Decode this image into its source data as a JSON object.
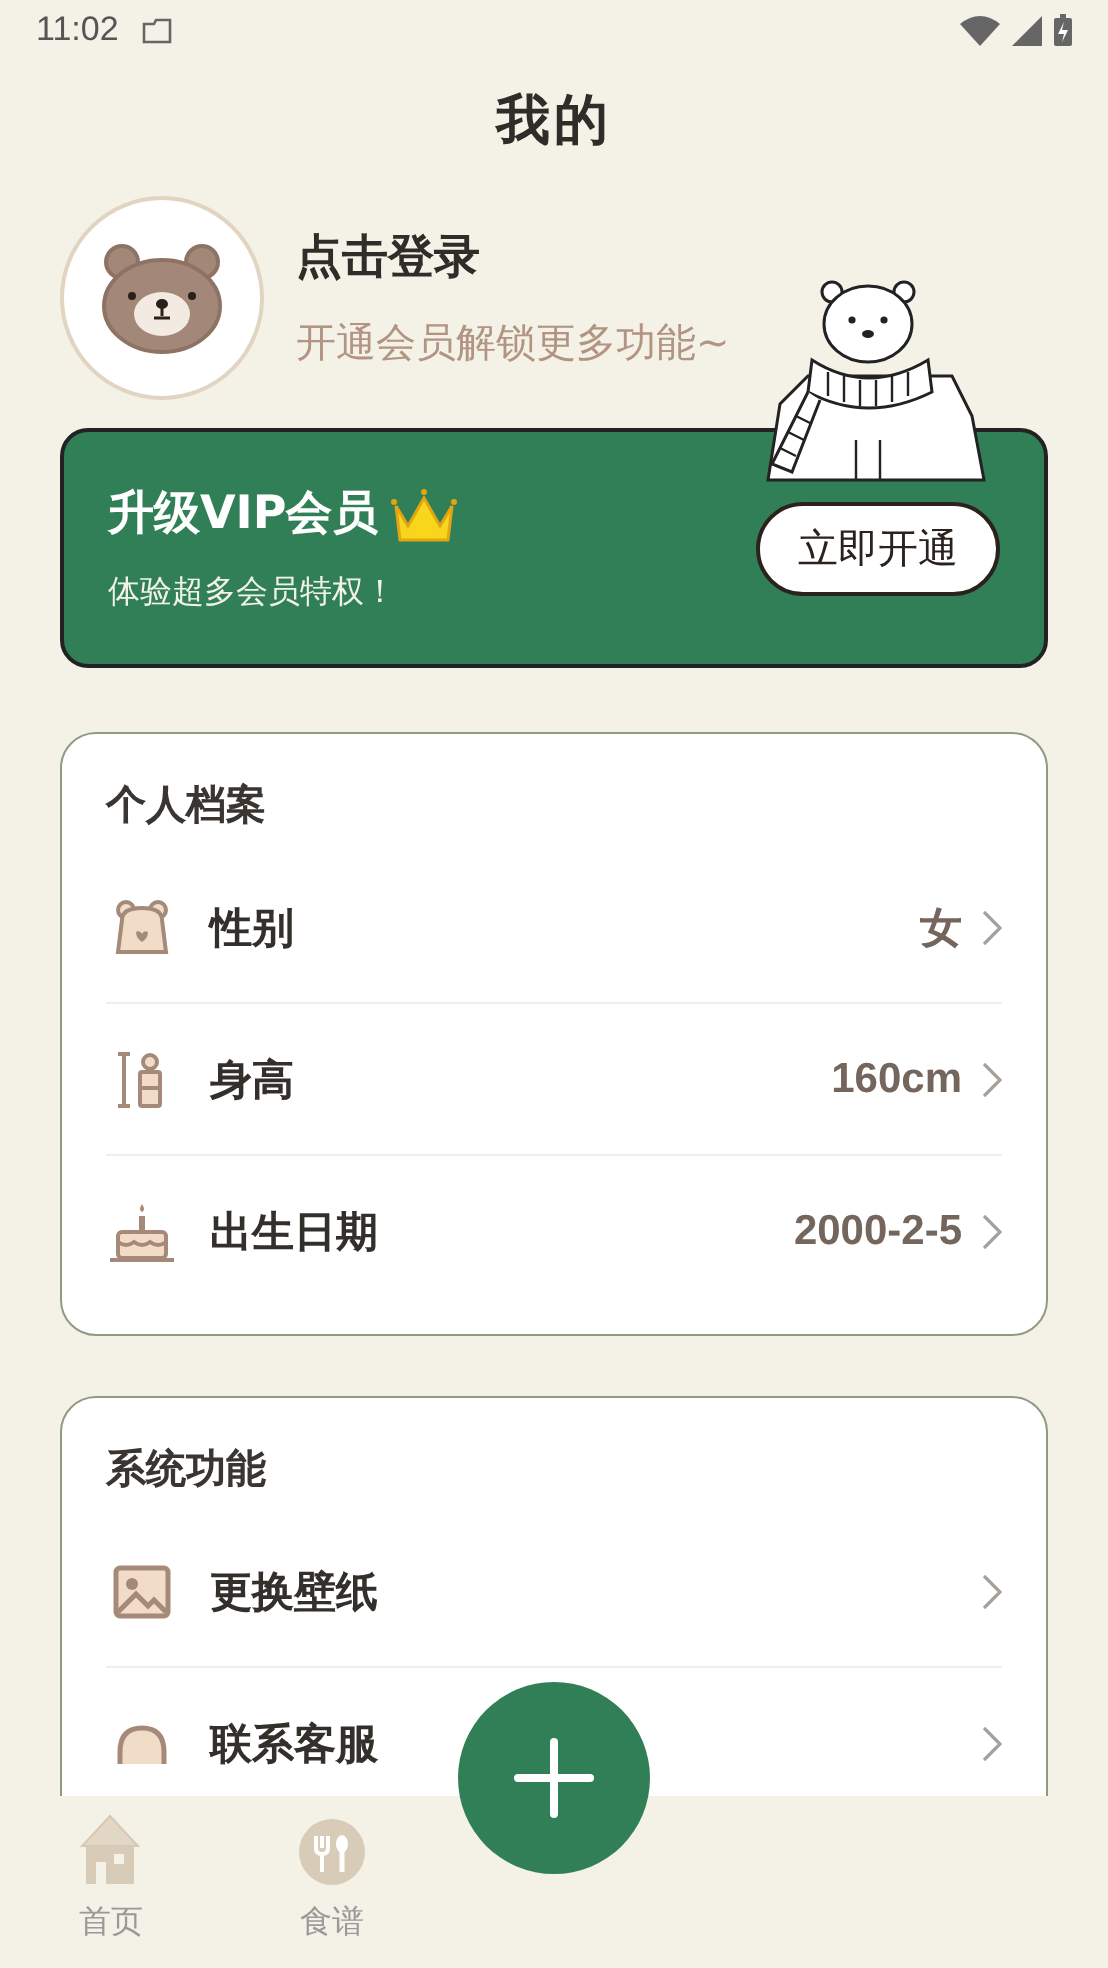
{
  "status_bar": {
    "time": "11:02"
  },
  "title": "我的",
  "profile": {
    "name": "点击登录",
    "subtitle": "开通会员解锁更多功能~"
  },
  "vip": {
    "title": "升级VIP会员",
    "subtitle": "体验超多会员特权！",
    "button": "立即开通"
  },
  "sections": [
    {
      "title": "个人档案",
      "items": [
        {
          "label": "性别",
          "value": "女"
        },
        {
          "label": "身高",
          "value": "160cm"
        },
        {
          "label": "出生日期",
          "value": "2000-2-5"
        }
      ]
    },
    {
      "title": "系统功能",
      "items": [
        {
          "label": "更换壁纸"
        },
        {
          "label": "联系客服"
        }
      ]
    }
  ],
  "nav": {
    "items": [
      {
        "label": "首页",
        "selected": false
      },
      {
        "label": "食谱",
        "selected": false
      }
    ]
  }
}
